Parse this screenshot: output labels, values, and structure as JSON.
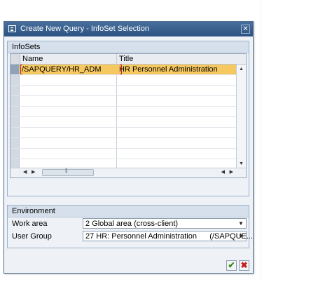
{
  "window": {
    "title": "Create New Query - InfoSet Selection",
    "close_glyph": "✕"
  },
  "infosets": {
    "panel_title": "InfoSets",
    "columns": [
      "Name",
      "Title"
    ],
    "rows": [
      {
        "name": "/SAPQUERY/HR_ADM",
        "title": "HR Personnel Administration",
        "selected": true
      }
    ],
    "empty_rows": 11
  },
  "environment": {
    "panel_title": "Environment",
    "work_area_label": "Work area",
    "work_area_value": "2 Global area (cross-client)",
    "user_group_label": "User Group",
    "user_group_value": "27 HR: Personnel Administration      (/SAPQUE..."
  },
  "buttons": {
    "ok_glyph": "✔",
    "cancel_glyph": "✖"
  },
  "colors": {
    "titlebar": "#2c5281",
    "selected_row": "#f6c860",
    "ok_icon": "#3a8a16",
    "cancel_icon": "#c81e1e"
  }
}
